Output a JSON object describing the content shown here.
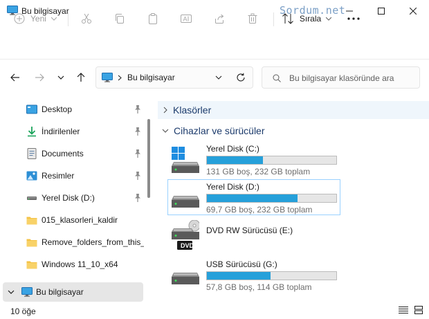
{
  "window": {
    "title": "Bu bilgisayar",
    "watermark": "Sordum.net"
  },
  "toolbar": {
    "new_label": "Yeni",
    "sort_label": "Sırala"
  },
  "address": {
    "location": "Bu bilgisayar",
    "search_placeholder": "Bu bilgisayar klasöründe ara"
  },
  "sidebar": {
    "items": [
      {
        "label": "Desktop",
        "icon": "desktop-icon",
        "pinned": true
      },
      {
        "label": "İndirilenler",
        "icon": "download-icon",
        "pinned": true
      },
      {
        "label": "Documents",
        "icon": "documents-icon",
        "pinned": true
      },
      {
        "label": "Resimler",
        "icon": "pictures-icon",
        "pinned": true
      },
      {
        "label": "Yerel Disk (D:)",
        "icon": "drive-icon",
        "pinned": true
      },
      {
        "label": "015_klasorleri_kaldir",
        "icon": "folder-icon",
        "pinned": false
      },
      {
        "label": "Remove_folders_from_this_p",
        "icon": "folder-icon",
        "pinned": false
      },
      {
        "label": "Windows 11_10_x64",
        "icon": "folder-icon",
        "pinned": false
      }
    ],
    "this_pc": "Bu bilgisayar"
  },
  "content": {
    "folders_group": "Klasörler",
    "devices_group": "Cihazlar ve sürücüler",
    "drives": [
      {
        "name": "Yerel Disk (C:)",
        "info": "131 GB boş, 232 GB toplam",
        "used_fraction": 0.435,
        "icon": "windows-drive-icon"
      },
      {
        "name": "Yerel Disk (D:)",
        "info": "69,7 GB boş, 232 GB toplam",
        "used_fraction": 0.7,
        "icon": "drive-icon"
      },
      {
        "name": "DVD RW Sürücüsü (E:)",
        "info": "",
        "icon": "dvd-drive-icon",
        "dvd_label": "DVD"
      },
      {
        "name": "USB Sürücüsü (G:)",
        "info": "57,8 GB boş, 114 GB toplam",
        "used_fraction": 0.49,
        "icon": "usb-drive-icon"
      }
    ]
  },
  "status": {
    "count": "10 öğe"
  },
  "colors": {
    "accent": "#26a0da",
    "selection_border": "#99d1ff",
    "group_text": "#1b3a6b"
  }
}
